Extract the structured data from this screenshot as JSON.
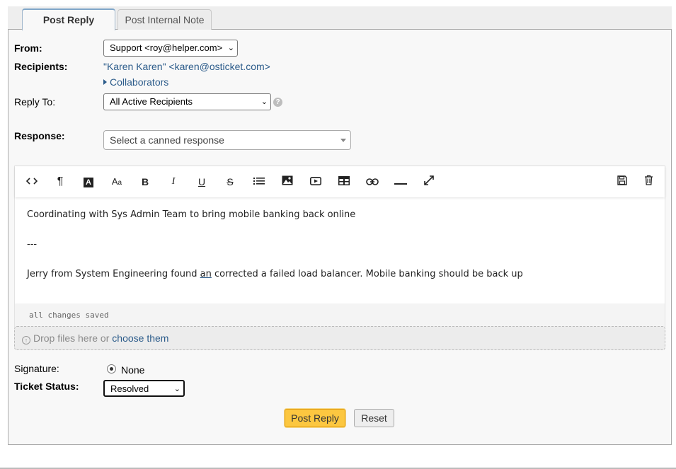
{
  "tabs": [
    {
      "label": "Post Reply",
      "active": true
    },
    {
      "label": "Post Internal Note",
      "active": false
    }
  ],
  "form": {
    "from_label": "From:",
    "from_value": "Support <roy@helper.com>",
    "recipients_label": "Recipients:",
    "recipients_value": "\"Karen Karen\" <karen@osticket.com>",
    "collaborators_label": "Collaborators",
    "reply_to_label": "Reply To:",
    "reply_to_value": "All Active Recipients",
    "response_label": "Response:",
    "canned_placeholder": "Select a canned response"
  },
  "toolbar": {
    "icons": [
      "code-icon",
      "paragraph-icon",
      "text-color-icon",
      "font-size-icon",
      "bold-icon",
      "italic-icon",
      "underline-icon",
      "strikethrough-icon",
      "list-icon",
      "image-icon",
      "video-icon",
      "table-icon",
      "link-icon",
      "horizontal-rule-icon",
      "fullscreen-icon",
      "save-draft-icon",
      "delete-draft-icon"
    ]
  },
  "editor": {
    "line1": "Coordinating with Sys Admin Team to bring mobile banking back online",
    "line2": "---",
    "line3_before": "Jerry from System Engineering found ",
    "line3_underlined": "an",
    "line3_after": " corrected a failed load balancer. Mobile banking should be back up",
    "status": "all changes saved"
  },
  "dropzone": {
    "text": "Drop files here or ",
    "link": "choose them"
  },
  "signature": {
    "label": "Signature:",
    "option": "None"
  },
  "ticket_status": {
    "label": "Ticket Status:",
    "value": "Resolved"
  },
  "buttons": {
    "post_reply": "Post Reply",
    "reset": "Reset"
  },
  "colors": {
    "link": "#2b5b8a",
    "primary_button": "#fcc740",
    "panel_bg": "#f8f8f8"
  }
}
